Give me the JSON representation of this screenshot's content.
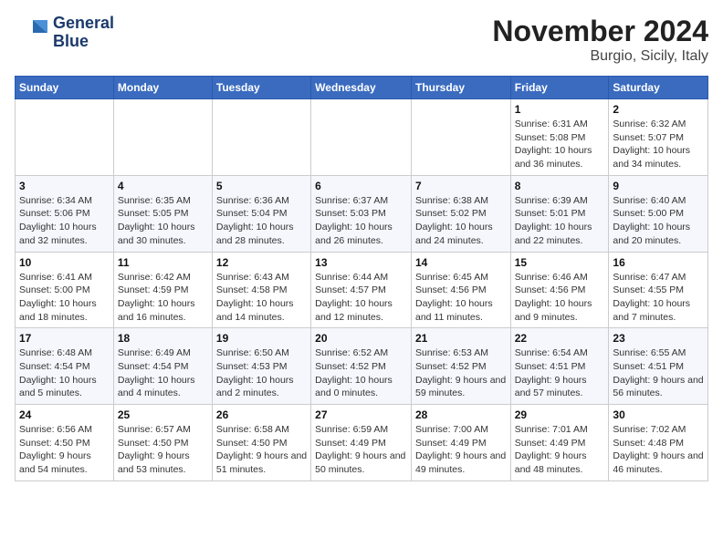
{
  "header": {
    "logo_line1": "General",
    "logo_line2": "Blue",
    "month": "November 2024",
    "location": "Burgio, Sicily, Italy"
  },
  "weekdays": [
    "Sunday",
    "Monday",
    "Tuesday",
    "Wednesday",
    "Thursday",
    "Friday",
    "Saturday"
  ],
  "weeks": [
    [
      {
        "day": "",
        "info": ""
      },
      {
        "day": "",
        "info": ""
      },
      {
        "day": "",
        "info": ""
      },
      {
        "day": "",
        "info": ""
      },
      {
        "day": "",
        "info": ""
      },
      {
        "day": "1",
        "info": "Sunrise: 6:31 AM\nSunset: 5:08 PM\nDaylight: 10 hours and 36 minutes."
      },
      {
        "day": "2",
        "info": "Sunrise: 6:32 AM\nSunset: 5:07 PM\nDaylight: 10 hours and 34 minutes."
      }
    ],
    [
      {
        "day": "3",
        "info": "Sunrise: 6:34 AM\nSunset: 5:06 PM\nDaylight: 10 hours and 32 minutes."
      },
      {
        "day": "4",
        "info": "Sunrise: 6:35 AM\nSunset: 5:05 PM\nDaylight: 10 hours and 30 minutes."
      },
      {
        "day": "5",
        "info": "Sunrise: 6:36 AM\nSunset: 5:04 PM\nDaylight: 10 hours and 28 minutes."
      },
      {
        "day": "6",
        "info": "Sunrise: 6:37 AM\nSunset: 5:03 PM\nDaylight: 10 hours and 26 minutes."
      },
      {
        "day": "7",
        "info": "Sunrise: 6:38 AM\nSunset: 5:02 PM\nDaylight: 10 hours and 24 minutes."
      },
      {
        "day": "8",
        "info": "Sunrise: 6:39 AM\nSunset: 5:01 PM\nDaylight: 10 hours and 22 minutes."
      },
      {
        "day": "9",
        "info": "Sunrise: 6:40 AM\nSunset: 5:00 PM\nDaylight: 10 hours and 20 minutes."
      }
    ],
    [
      {
        "day": "10",
        "info": "Sunrise: 6:41 AM\nSunset: 5:00 PM\nDaylight: 10 hours and 18 minutes."
      },
      {
        "day": "11",
        "info": "Sunrise: 6:42 AM\nSunset: 4:59 PM\nDaylight: 10 hours and 16 minutes."
      },
      {
        "day": "12",
        "info": "Sunrise: 6:43 AM\nSunset: 4:58 PM\nDaylight: 10 hours and 14 minutes."
      },
      {
        "day": "13",
        "info": "Sunrise: 6:44 AM\nSunset: 4:57 PM\nDaylight: 10 hours and 12 minutes."
      },
      {
        "day": "14",
        "info": "Sunrise: 6:45 AM\nSunset: 4:56 PM\nDaylight: 10 hours and 11 minutes."
      },
      {
        "day": "15",
        "info": "Sunrise: 6:46 AM\nSunset: 4:56 PM\nDaylight: 10 hours and 9 minutes."
      },
      {
        "day": "16",
        "info": "Sunrise: 6:47 AM\nSunset: 4:55 PM\nDaylight: 10 hours and 7 minutes."
      }
    ],
    [
      {
        "day": "17",
        "info": "Sunrise: 6:48 AM\nSunset: 4:54 PM\nDaylight: 10 hours and 5 minutes."
      },
      {
        "day": "18",
        "info": "Sunrise: 6:49 AM\nSunset: 4:54 PM\nDaylight: 10 hours and 4 minutes."
      },
      {
        "day": "19",
        "info": "Sunrise: 6:50 AM\nSunset: 4:53 PM\nDaylight: 10 hours and 2 minutes."
      },
      {
        "day": "20",
        "info": "Sunrise: 6:52 AM\nSunset: 4:52 PM\nDaylight: 10 hours and 0 minutes."
      },
      {
        "day": "21",
        "info": "Sunrise: 6:53 AM\nSunset: 4:52 PM\nDaylight: 9 hours and 59 minutes."
      },
      {
        "day": "22",
        "info": "Sunrise: 6:54 AM\nSunset: 4:51 PM\nDaylight: 9 hours and 57 minutes."
      },
      {
        "day": "23",
        "info": "Sunrise: 6:55 AM\nSunset: 4:51 PM\nDaylight: 9 hours and 56 minutes."
      }
    ],
    [
      {
        "day": "24",
        "info": "Sunrise: 6:56 AM\nSunset: 4:50 PM\nDaylight: 9 hours and 54 minutes."
      },
      {
        "day": "25",
        "info": "Sunrise: 6:57 AM\nSunset: 4:50 PM\nDaylight: 9 hours and 53 minutes."
      },
      {
        "day": "26",
        "info": "Sunrise: 6:58 AM\nSunset: 4:50 PM\nDaylight: 9 hours and 51 minutes."
      },
      {
        "day": "27",
        "info": "Sunrise: 6:59 AM\nSunset: 4:49 PM\nDaylight: 9 hours and 50 minutes."
      },
      {
        "day": "28",
        "info": "Sunrise: 7:00 AM\nSunset: 4:49 PM\nDaylight: 9 hours and 49 minutes."
      },
      {
        "day": "29",
        "info": "Sunrise: 7:01 AM\nSunset: 4:49 PM\nDaylight: 9 hours and 48 minutes."
      },
      {
        "day": "30",
        "info": "Sunrise: 7:02 AM\nSunset: 4:48 PM\nDaylight: 9 hours and 46 minutes."
      }
    ]
  ]
}
